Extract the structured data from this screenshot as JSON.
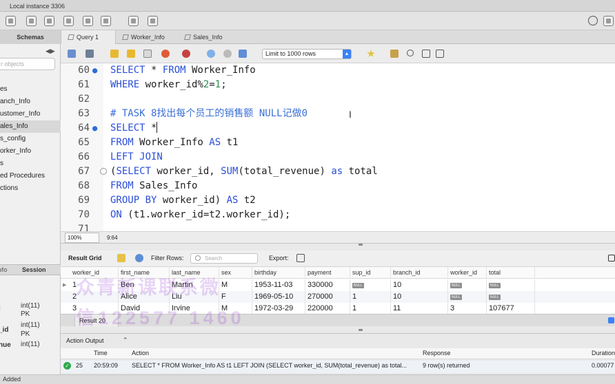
{
  "window": {
    "connection_tab": "Local instance 3306"
  },
  "tabs": {
    "schemas": "Schemas",
    "query": "Query 1",
    "worker_info": "Worker_Info",
    "sales_info": "Sales_Info"
  },
  "sidebar": {
    "filter_placeholder": "r objects",
    "items": [
      "es",
      "anch_Info",
      "ustomer_Info",
      "ales_Info",
      "s_config",
      "orker_Info",
      "s",
      "ed Procedures",
      "ctions"
    ],
    "info_tabs": {
      "info": "Info",
      "session": "Session"
    },
    "columns": [
      {
        "name": "l",
        "type": "int(11)",
        "extra": "PK"
      },
      {
        "name": "_id",
        "type": "int(11)",
        "extra": "PK"
      },
      {
        "name": "nue",
        "type": "int(11)",
        "extra": ""
      }
    ]
  },
  "editor_toolbar": {
    "limit": "Limit to 1000 rows"
  },
  "editor": {
    "lines": [
      {
        "n": "60",
        "dot": true,
        "fold": false,
        "parts": [
          [
            "kw",
            "SELECT"
          ],
          [
            "id",
            " * "
          ],
          [
            "kw",
            "FROM"
          ],
          [
            "id",
            " Worker_Info"
          ]
        ]
      },
      {
        "n": "61",
        "dot": false,
        "fold": false,
        "parts": [
          [
            "kw",
            "WHERE"
          ],
          [
            "id",
            " worker_id%"
          ],
          [
            "num",
            "2"
          ],
          [
            "id",
            "="
          ],
          [
            "num",
            "1"
          ],
          [
            "id",
            ";"
          ]
        ]
      },
      {
        "n": "62",
        "dot": false,
        "fold": false,
        "parts": []
      },
      {
        "n": "63",
        "dot": false,
        "fold": false,
        "parts": [
          [
            "cm",
            "# TASK 8找出每个员工的销售额 NULL记做0"
          ]
        ]
      },
      {
        "n": "64",
        "dot": true,
        "fold": false,
        "parts": [
          [
            "kw",
            "SELECT"
          ],
          [
            "id",
            " *"
          ]
        ],
        "cursor": true
      },
      {
        "n": "65",
        "dot": false,
        "fold": false,
        "parts": [
          [
            "kw",
            "FROM"
          ],
          [
            "id",
            " Worker_Info "
          ],
          [
            "kw",
            "AS"
          ],
          [
            "id",
            " t1"
          ]
        ]
      },
      {
        "n": "66",
        "dot": false,
        "fold": false,
        "parts": [
          [
            "kw",
            "LEFT JOIN"
          ]
        ]
      },
      {
        "n": "67",
        "dot": false,
        "fold": true,
        "parts": [
          [
            "id",
            "("
          ],
          [
            "kw",
            "SELECT"
          ],
          [
            "id",
            " worker_id, "
          ],
          [
            "fn",
            "SUM"
          ],
          [
            "id",
            "(total_revenue) "
          ],
          [
            "kw",
            "as"
          ],
          [
            "id",
            " total"
          ]
        ]
      },
      {
        "n": "68",
        "dot": false,
        "fold": false,
        "parts": [
          [
            "kw",
            "FROM"
          ],
          [
            "id",
            " Sales_Info"
          ]
        ]
      },
      {
        "n": "69",
        "dot": false,
        "fold": false,
        "parts": [
          [
            "kw",
            "GROUP BY"
          ],
          [
            "id",
            " worker_id) "
          ],
          [
            "kw",
            "AS"
          ],
          [
            "id",
            " t2"
          ]
        ]
      },
      {
        "n": "70",
        "dot": false,
        "fold": false,
        "parts": [
          [
            "kw",
            "ON"
          ],
          [
            "id",
            " (t1.worker_id=t2.worker_id);"
          ]
        ]
      },
      {
        "n": "71",
        "dot": false,
        "fold": false,
        "parts": []
      }
    ],
    "zoom": "100%",
    "position": "9:64"
  },
  "result": {
    "grid_label": "Result Grid",
    "filter_label": "Filter Rows:",
    "search_placeholder": "Search",
    "export_label": "Export:",
    "columns": [
      "worker_id",
      "first_name",
      "last_name",
      "sex",
      "birthday",
      "payment",
      "sup_id",
      "branch_id",
      "worker_id",
      "total"
    ],
    "rows": [
      [
        "1",
        "Ben",
        "Martin",
        "M",
        "1953-11-03",
        "330000",
        "NULL",
        "10",
        "NULL",
        "NULL"
      ],
      [
        "2",
        "Alice",
        "Liu",
        "F",
        "1969-05-10",
        "270000",
        "1",
        "10",
        "NULL",
        "NULL"
      ],
      [
        "3",
        "David",
        "Irvine",
        "M",
        "1972-03-29",
        "220000",
        "1",
        "11",
        "3",
        "107677"
      ]
    ],
    "tab_label": "Result 20"
  },
  "output": {
    "selector": "Action Output",
    "columns": [
      "Time",
      "Action",
      "Response",
      "Duration"
    ],
    "row": {
      "num": "25",
      "time": "20:59:09",
      "action": "SELECT * FROM Worker_Info AS t1 LEFT JOIN (SELECT worker_id, SUM(total_revenue) as total...",
      "response": "9 row(s) returned",
      "duration": "0.00077"
    }
  },
  "statusbar": {
    "text": "Added"
  },
  "watermark": {
    "line1": "众青新课联系微",
    "line2": "信122577 1460"
  }
}
